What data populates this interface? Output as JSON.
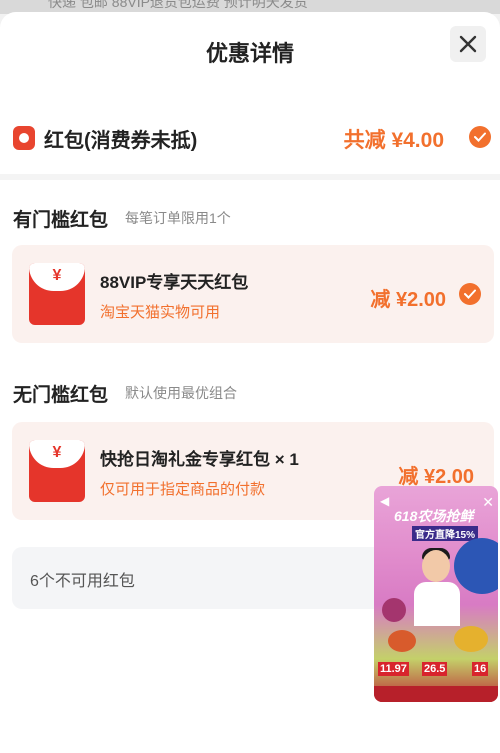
{
  "header": {
    "background_text": "快递 包邮 88VIP退货包运费 预计明天发货",
    "title": "优惠详情",
    "close_icon": "close-icon"
  },
  "summary": {
    "label": "红包(消费券未抵)",
    "total": "共减 ¥4.00",
    "icon": "red-packet-icon",
    "checked": true
  },
  "threshold_section": {
    "title": "有门槛红包",
    "subtitle": "每笔订单限用1个",
    "card": {
      "yen": "¥",
      "title": "88VIP专享天天红包",
      "desc": "淘宝天猫实物可用",
      "amount": "减 ¥2.00",
      "checked": true
    }
  },
  "no_threshold_section": {
    "title": "无门槛红包",
    "subtitle": "默认使用最优组合",
    "card": {
      "yen": "¥",
      "title": "快抢日淘礼金专享红包 × 1",
      "desc": "仅可用于指定商品的付款",
      "amount": "减 ¥2.00"
    }
  },
  "unavailable": {
    "label": "6个不可用红包"
  },
  "live_pip": {
    "banner": "618农场抢鲜",
    "sub": "官方直降15%",
    "prices": [
      "11.97",
      "26.5",
      "16"
    ],
    "close_icon": "close-icon",
    "speaker_icon": "speaker-icon"
  },
  "colors": {
    "accent": "#f2702d",
    "red": "#e5352b",
    "card_bg": "#fbf1ee"
  }
}
